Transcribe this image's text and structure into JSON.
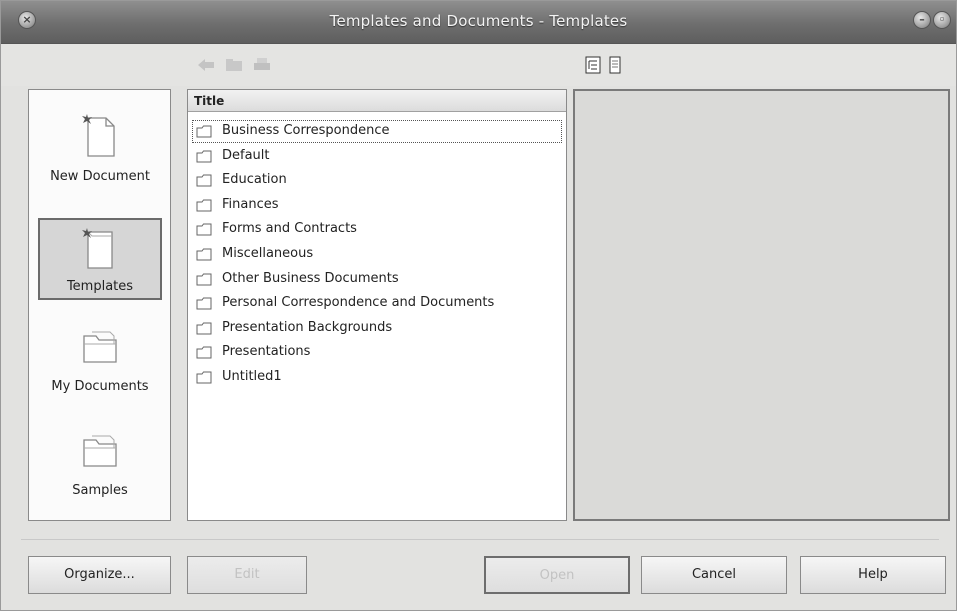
{
  "window": {
    "title": "Templates and Documents - Templates"
  },
  "toolbar": {
    "back_icon": "back-arrow-icon",
    "up_icon": "folder-up-icon",
    "print_icon": "print-icon",
    "details_view_icon": "details-view-icon",
    "preview_view_icon": "document-preview-icon"
  },
  "sidebar": {
    "items": [
      {
        "label": "New Document",
        "icon": "new-document-icon",
        "active": false
      },
      {
        "label": "Templates",
        "icon": "templates-icon",
        "active": true
      },
      {
        "label": "My Documents",
        "icon": "my-documents-folder-icon",
        "active": false
      },
      {
        "label": "Samples",
        "icon": "samples-folder-icon",
        "active": false
      }
    ]
  },
  "list": {
    "column_header": "Title",
    "rows": [
      "Business Correspondence",
      "Default",
      "Education",
      "Finances",
      "Forms and Contracts",
      "Miscellaneous",
      "Other Business Documents",
      "Personal Correspondence and Documents",
      "Presentation Backgrounds",
      "Presentations",
      "Untitled1"
    ],
    "selected_index": 0
  },
  "buttons": {
    "organize": "Organize...",
    "edit": "Edit",
    "open": "Open",
    "cancel": "Cancel",
    "help": "Help"
  }
}
